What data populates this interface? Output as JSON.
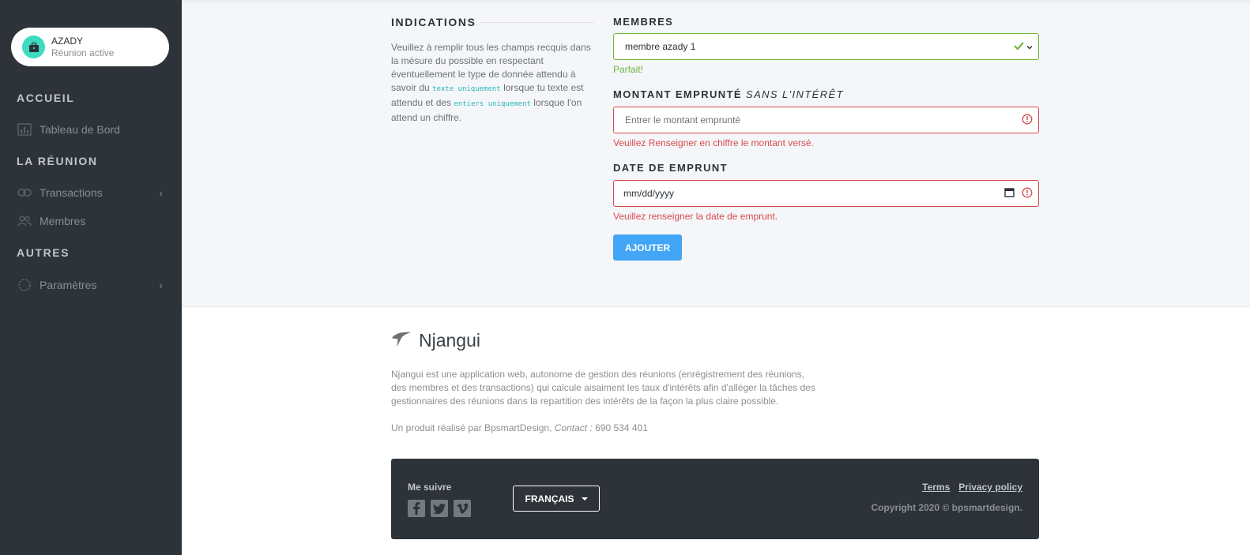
{
  "sidebar": {
    "account": {
      "name": "AZADY",
      "status": "Réunion active"
    },
    "sections": [
      {
        "title": "ACCUEIL",
        "items": [
          {
            "label": "Tableau de Bord",
            "icon": "chart-icon"
          }
        ]
      },
      {
        "title": "LA RÉUNION",
        "items": [
          {
            "label": "Transactions",
            "icon": "link-icon",
            "has_chevron": true
          },
          {
            "label": "Membres",
            "icon": "users-icon"
          }
        ]
      },
      {
        "title": "AUTRES",
        "items": [
          {
            "label": "Paramètres",
            "icon": "loader-icon",
            "has_chevron": true
          }
        ]
      }
    ]
  },
  "indications": {
    "title": "INDICATIONS",
    "text_1": "Veuillez à remplir tous les champs recquis dans la mésure du possible en respectant éventuellement le type de donnée attendu à savoir du ",
    "code_1": "texte uniquement",
    "text_2": " lorsque tu texte est attendu et des ",
    "code_2": "entiers uniquement",
    "text_3": " lorsque l'on attend un chiffre."
  },
  "form": {
    "membres": {
      "label": "MEMBRES",
      "value": "membre azady 1",
      "status_message": "Parfait!"
    },
    "montant": {
      "label": "MONTANT EMPRUNTÉ",
      "label_suffix": "SANS L'INTÉRÊT",
      "placeholder": "Entrer le montant emprunté",
      "error": "Veuillez Renseigner en chiffre le montant versé."
    },
    "date": {
      "label": "DATE DE EMPRUNT",
      "placeholder": "mm/dd/yyyy",
      "error": "Veuillez renseigner la date de emprunt."
    },
    "submit_label": "AJOUTER"
  },
  "footer": {
    "brand": "Njangui",
    "about": "Njangui est une application web, autonome de gestion des réunions (enrégistrement des réunions, des membres et des transactions) qui calcule aisaiment les taux d'intérêts afin d'alléger la tâches des gestionnaires des réunions dans la repartition des intérêts de la façon la plus claire possible.",
    "credit_prefix": "Un produit réalisé par BpsmartDesign, ",
    "contact_label": "Contact :",
    "contact_value": " 690 534 401",
    "follow_label": "Me suivre",
    "social_icons": [
      "facebook-icon",
      "twitter-icon",
      "vimeo-icon"
    ],
    "language": "FRANÇAIS",
    "links": [
      "Terms",
      "Privacy policy"
    ],
    "copyright": "Copyright 2020 © bpsmartdesign."
  },
  "colors": {
    "sidebar_bg": "#2d3339",
    "accent": "#42a5f5",
    "success": "#6fb73c",
    "error": "#d64b4b",
    "avatar": "#3ddbc1"
  }
}
